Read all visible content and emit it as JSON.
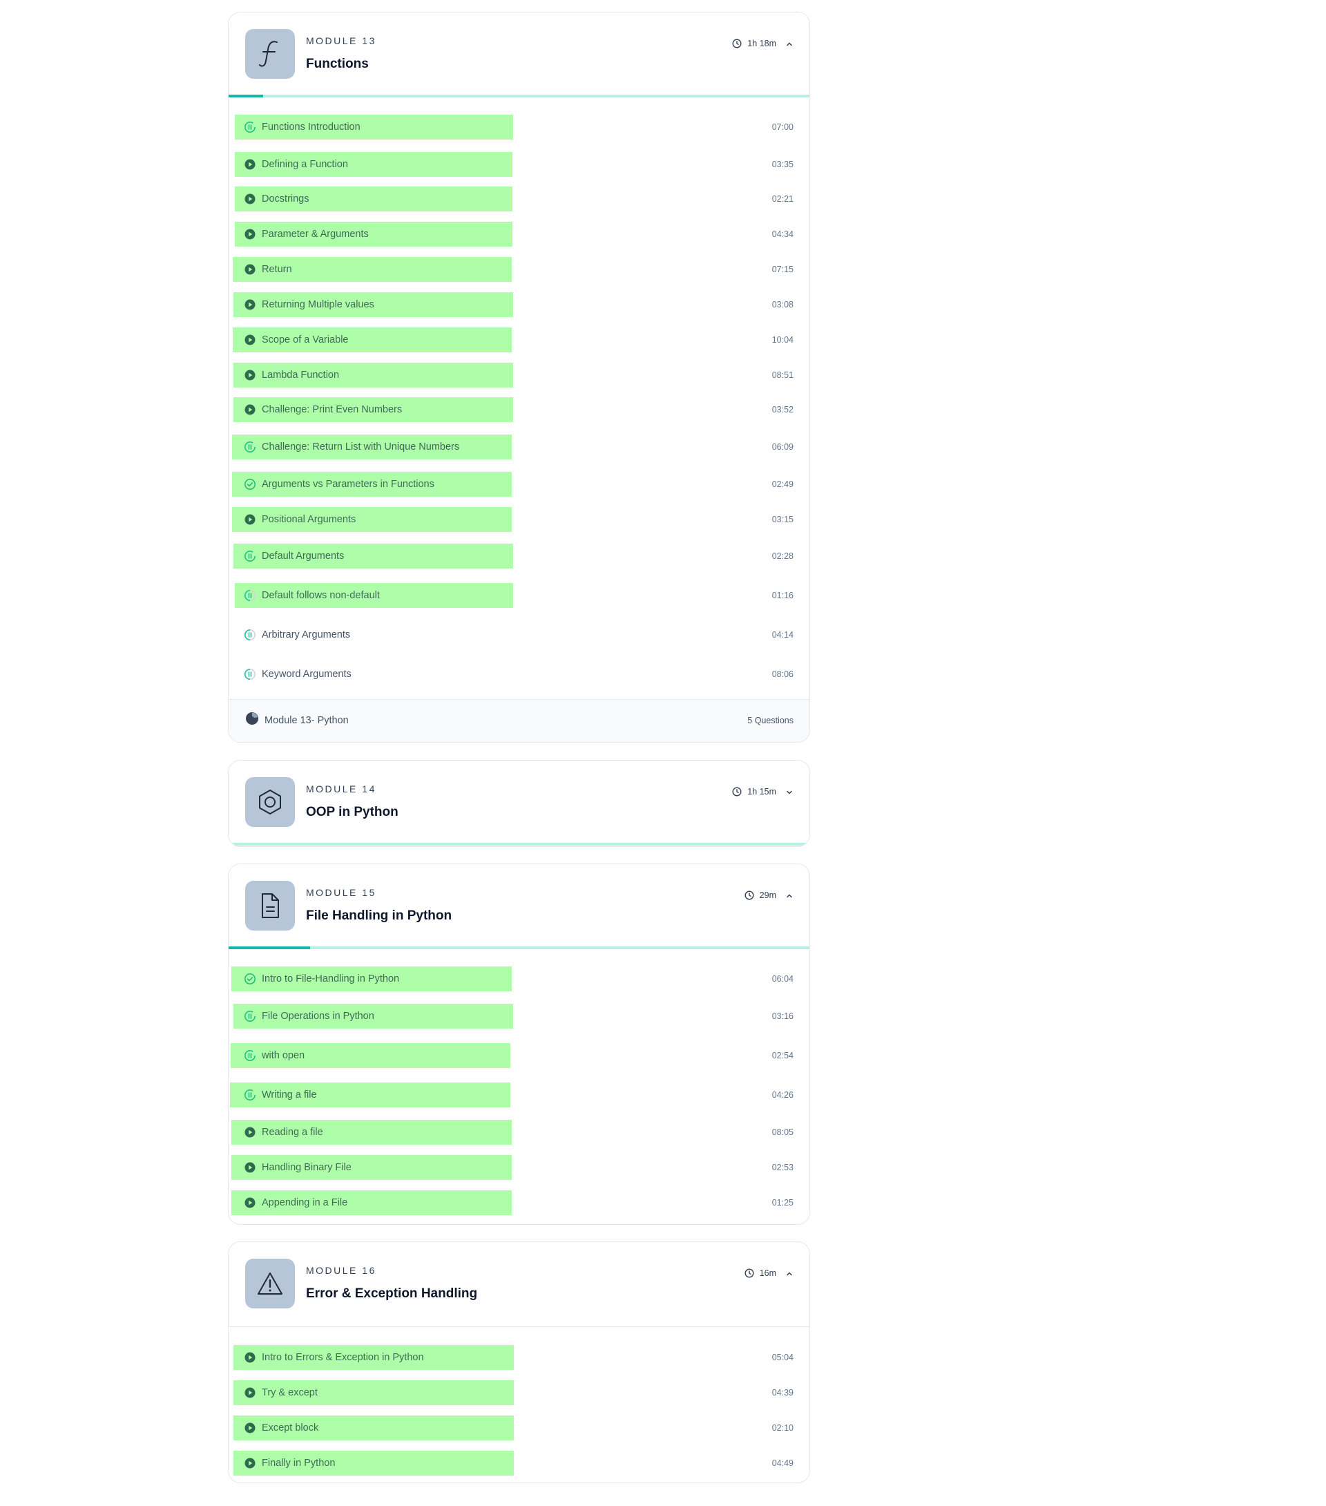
{
  "modules": [
    {
      "label": "MODULE 13",
      "title": "Functions",
      "duration": "1h 18m",
      "expanded": true,
      "icon": "function-icon",
      "progress_fraction": 0.06,
      "lessons": [
        {
          "title": "Functions Introduction",
          "duration": "07:00",
          "status": "in-progress"
        },
        {
          "title": "Defining a Function",
          "duration": "03:35",
          "status": "video"
        },
        {
          "title": "Docstrings",
          "duration": "02:21",
          "status": "video"
        },
        {
          "title": "Parameter & Arguments",
          "duration": "04:34",
          "status": "video"
        },
        {
          "title": "Return",
          "duration": "07:15",
          "status": "video"
        },
        {
          "title": "Returning Multiple values",
          "duration": "03:08",
          "status": "video"
        },
        {
          "title": "Scope of a Variable",
          "duration": "10:04",
          "status": "video"
        },
        {
          "title": "Lambda Function",
          "duration": "08:51",
          "status": "video"
        },
        {
          "title": "Challenge: Print Even Numbers",
          "duration": "03:52",
          "status": "video"
        },
        {
          "title": "Challenge: Return List with Unique Numbers",
          "duration": "06:09",
          "status": "in-progress"
        },
        {
          "title": "Arguments vs Parameters in Functions",
          "duration": "02:49",
          "status": "completed"
        },
        {
          "title": "Positional Arguments",
          "duration": "03:15",
          "status": "video"
        },
        {
          "title": "Default Arguments",
          "duration": "02:28",
          "status": "in-progress"
        },
        {
          "title": "Default follows non-default",
          "duration": "01:16",
          "status": "partial"
        },
        {
          "title": "Arbitrary Arguments",
          "duration": "04:14",
          "status": "partial"
        },
        {
          "title": "Keyword Arguments",
          "duration": "08:06",
          "status": "partial"
        }
      ],
      "quiz": {
        "title": "Module 13- Python",
        "count": "5 Questions"
      }
    },
    {
      "label": "MODULE 14",
      "title": "OOP in Python",
      "duration": "1h 15m",
      "expanded": false,
      "icon": "hexagon-icon",
      "progress_fraction": 0
    },
    {
      "label": "MODULE 15",
      "title": "File Handling in Python",
      "duration": "29m",
      "expanded": true,
      "icon": "document-icon",
      "progress_fraction": 0.14,
      "lessons": [
        {
          "title": "Intro to File-Handling in Python",
          "duration": "06:04",
          "status": "completed"
        },
        {
          "title": "File Operations in Python",
          "duration": "03:16",
          "status": "in-progress"
        },
        {
          "title": "with open",
          "duration": "02:54",
          "status": "in-progress"
        },
        {
          "title": "Writing a file",
          "duration": "04:26",
          "status": "in-progress"
        },
        {
          "title": "Reading a file",
          "duration": "08:05",
          "status": "video"
        },
        {
          "title": "Handling Binary File",
          "duration": "02:53",
          "status": "video"
        },
        {
          "title": "Appending in a File",
          "duration": "01:25",
          "status": "video"
        }
      ]
    },
    {
      "label": "MODULE 16",
      "title": "Error & Exception Handling",
      "duration": "16m",
      "expanded": true,
      "icon": "warning-icon",
      "lessons": [
        {
          "title": "Intro to Errors & Exception in Python",
          "duration": "05:04",
          "status": "video"
        },
        {
          "title": "Try & except",
          "duration": "04:39",
          "status": "video"
        },
        {
          "title": "Except block",
          "duration": "02:10",
          "status": "video"
        },
        {
          "title": "Finally in Python",
          "duration": "04:49",
          "status": "video"
        }
      ]
    }
  ],
  "colors": {
    "highlight": "#adfda9",
    "accent": "#14b8a6",
    "progress_track": "#b5efe3",
    "icon_tile": "#b7c5d8"
  }
}
